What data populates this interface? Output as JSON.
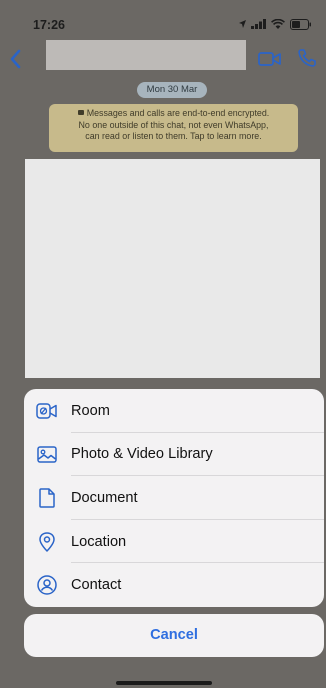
{
  "status_bar": {
    "time": "17:26"
  },
  "chat": {
    "date_pill": "Mon 30 Mar",
    "encryption_notice_lines": [
      "Messages and calls are end-to-end encrypted.",
      "No one outside of this chat, not even WhatsApp,",
      "can read or listen to them. Tap to learn more."
    ]
  },
  "action_sheet": {
    "items": [
      {
        "label": "Room",
        "icon": "room-video-icon"
      },
      {
        "label": "Photo & Video Library",
        "icon": "photo-library-icon"
      },
      {
        "label": "Document",
        "icon": "document-icon"
      },
      {
        "label": "Location",
        "icon": "location-icon"
      },
      {
        "label": "Contact",
        "icon": "contact-icon"
      }
    ],
    "cancel_label": "Cancel"
  },
  "colors": {
    "accent_blue": "#2f6fe0",
    "sheet_background": "#f3f2f3",
    "encryption_notice": "#c7ba8b"
  }
}
